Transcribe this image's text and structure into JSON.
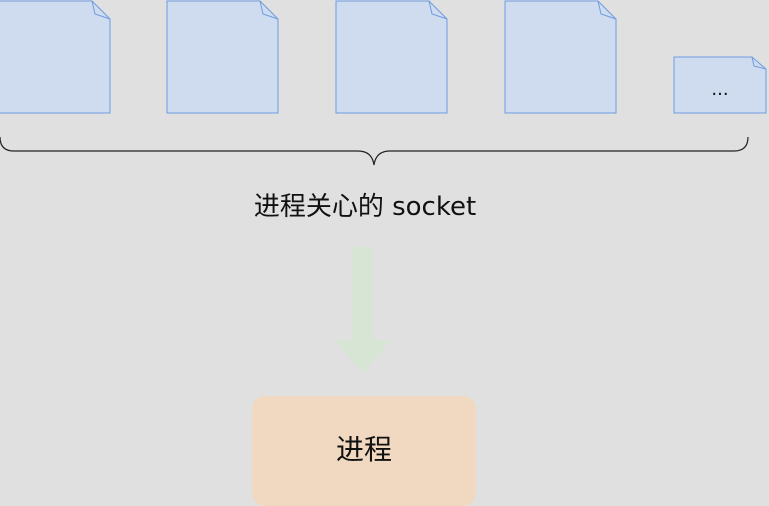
{
  "files": {
    "count_full": 4,
    "more_label": "..."
  },
  "brace_label": "进程关心的 socket",
  "process_label": "进程",
  "colors": {
    "background": "#e0e0e0",
    "file_fill": "#cfdbee",
    "file_stroke": "#6e9de0",
    "arrow_fill": "#d6e5d4",
    "process_fill": "#f1d9c1",
    "text": "#111111",
    "brace": "#222222"
  }
}
